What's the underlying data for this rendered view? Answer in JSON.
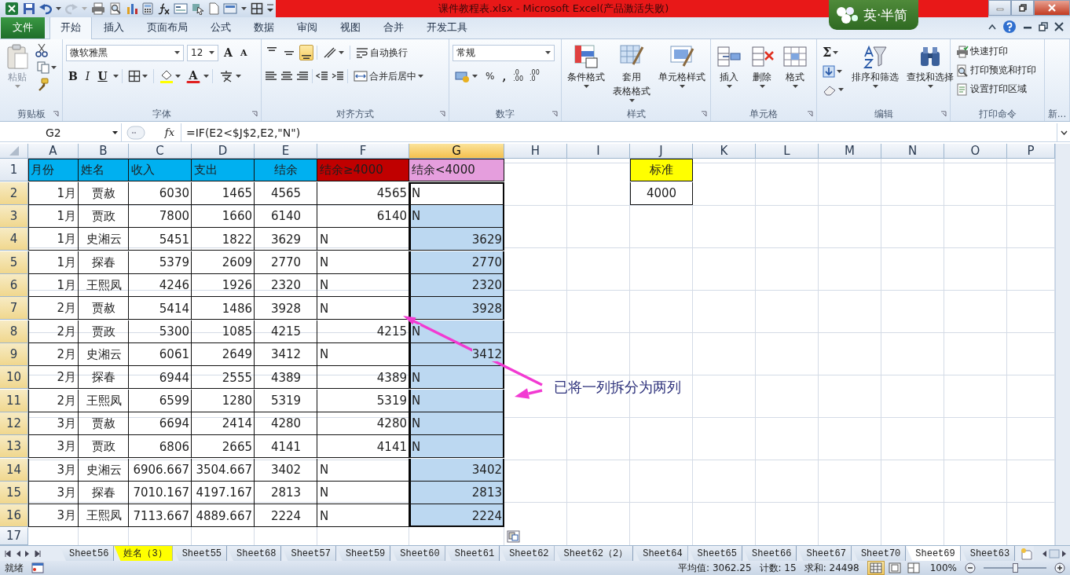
{
  "window": {
    "title": "课件教程表.xlsx - Microsoft Excel(产品激活失败)",
    "ime_badge": "英·半简"
  },
  "ribbon_tabs": [
    {
      "label": "文件",
      "kind": "file",
      "selected": false
    },
    {
      "label": "开始",
      "kind": "tab",
      "selected": true
    },
    {
      "label": "插入",
      "kind": "tab",
      "selected": false
    },
    {
      "label": "页面布局",
      "kind": "tab",
      "selected": false
    },
    {
      "label": "公式",
      "kind": "tab",
      "selected": false
    },
    {
      "label": "数据",
      "kind": "tab",
      "selected": false
    },
    {
      "label": "审阅",
      "kind": "tab",
      "selected": false
    },
    {
      "label": "视图",
      "kind": "tab",
      "selected": false
    },
    {
      "label": "合并",
      "kind": "tab",
      "selected": false
    },
    {
      "label": "开发工具",
      "kind": "tab",
      "selected": false
    }
  ],
  "ribbon": {
    "groups": [
      {
        "kind": "clipboard",
        "label": "剪贴板",
        "paste": "粘贴"
      },
      {
        "kind": "font",
        "label": "字体",
        "font_name": "微软雅黑",
        "font_size": "12",
        "grow": "A",
        "shrink": "A",
        "bold": "B",
        "italic": "I",
        "underline": "U",
        "font_color": "A"
      },
      {
        "kind": "alignment",
        "label": "对齐方式",
        "vertical_align": [
          {
            "selected": false
          },
          {
            "selected": false
          },
          {
            "selected": true
          }
        ],
        "wrap_text": "自动换行",
        "merge_center": "合并后居中"
      },
      {
        "kind": "number",
        "label": "数字",
        "format": "常规",
        "percent": "%",
        "comma": ",",
        "decimals": [
          {
            "top": ".0",
            "bottom": ".00"
          },
          {
            "top": ".00",
            "bottom": ".0"
          }
        ]
      },
      {
        "kind": "styles",
        "label": "样式",
        "buttons": [
          {
            "lines": [
              "条件格式"
            ]
          },
          {
            "lines": [
              "套用",
              "表格格式"
            ]
          },
          {
            "lines": [
              "单元格样式"
            ]
          }
        ]
      },
      {
        "kind": "cells",
        "label": "单元格",
        "buttons": [
          {
            "lines": [
              "插入"
            ]
          },
          {
            "lines": [
              "删除"
            ]
          },
          {
            "lines": [
              "格式"
            ]
          }
        ]
      },
      {
        "kind": "editing",
        "label": "编辑",
        "sum": "Σ",
        "buttons": [
          {
            "lines": [
              "排序和筛选"
            ]
          },
          {
            "lines": [
              "查找和选择"
            ]
          }
        ]
      },
      {
        "kind": "print",
        "label": "打印命令",
        "items": [
          "快速打印",
          "打印预览和打印",
          "设置打印区域"
        ]
      },
      {
        "kind": "more",
        "label": "新..."
      }
    ]
  },
  "formula_bar": {
    "name_box": "G2",
    "function_icon": "fx",
    "formula": "=IF(E2<$J$2,E2,\"N\")"
  },
  "grid": {
    "columns": [
      {
        "label": "A",
        "selected": false
      },
      {
        "label": "B",
        "selected": false
      },
      {
        "label": "C",
        "selected": false
      },
      {
        "label": "D",
        "selected": false
      },
      {
        "label": "E",
        "selected": false
      },
      {
        "label": "F",
        "selected": false
      },
      {
        "label": "G",
        "selected": true
      },
      {
        "label": "H",
        "selected": false
      },
      {
        "label": "I",
        "selected": false
      },
      {
        "label": "J",
        "selected": false
      },
      {
        "label": "K",
        "selected": false
      },
      {
        "label": "L",
        "selected": false
      },
      {
        "label": "M",
        "selected": false
      },
      {
        "label": "N",
        "selected": false
      },
      {
        "label": "O",
        "selected": false
      },
      {
        "label": "P",
        "selected": false
      }
    ],
    "rows": [
      {
        "label": "1",
        "selected": false,
        "cells": [
          {
            "text": "月份",
            "color": "#00b0f0"
          },
          {
            "text": "姓名",
            "color": "#00b0f0"
          },
          {
            "text": "收入",
            "color": "#00b0f0"
          },
          {
            "text": "支出",
            "color": "#00b0f0"
          },
          {
            "text": "结余",
            "color": "#00b0f0"
          },
          {
            "text": "结余≥4000",
            "color": "#c00000"
          },
          {
            "text": "结余<4000",
            "color": "#e59edd"
          }
        ],
        "criteria_cell": {
          "text": "标准",
          "color": "#ffff00"
        }
      },
      {
        "label": "2",
        "selected": true,
        "cells": [
          "1月",
          "贾赦",
          "6030",
          "1465",
          "4565",
          "4565",
          "N"
        ],
        "criteria_cell": {
          "text": "4000"
        }
      },
      {
        "label": "3",
        "selected": true,
        "cells": [
          "1月",
          "贾政",
          "7800",
          "1660",
          "6140",
          "6140",
          "N"
        ]
      },
      {
        "label": "4",
        "selected": true,
        "cells": [
          "1月",
          "史湘云",
          "5451",
          "1822",
          "3629",
          "N",
          "3629"
        ]
      },
      {
        "label": "5",
        "selected": true,
        "cells": [
          "1月",
          "探春",
          "5379",
          "2609",
          "2770",
          "N",
          "2770"
        ]
      },
      {
        "label": "6",
        "selected": true,
        "cells": [
          "1月",
          "王熙凤",
          "4246",
          "1926",
          "2320",
          "N",
          "2320"
        ]
      },
      {
        "label": "7",
        "selected": true,
        "cells": [
          "2月",
          "贾赦",
          "5414",
          "1486",
          "3928",
          "N",
          "3928"
        ]
      },
      {
        "label": "8",
        "selected": true,
        "cells": [
          "2月",
          "贾政",
          "5300",
          "1085",
          "4215",
          "4215",
          "N"
        ]
      },
      {
        "label": "9",
        "selected": true,
        "cells": [
          "2月",
          "史湘云",
          "6061",
          "2649",
          "3412",
          "N",
          "3412"
        ]
      },
      {
        "label": "10",
        "selected": true,
        "cells": [
          "2月",
          "探春",
          "6944",
          "2555",
          "4389",
          "4389",
          "N"
        ]
      },
      {
        "label": "11",
        "selected": true,
        "cells": [
          "2月",
          "王熙凤",
          "6599",
          "1280",
          "5319",
          "5319",
          "N"
        ]
      },
      {
        "label": "12",
        "selected": true,
        "cells": [
          "3月",
          "贾赦",
          "6694",
          "2414",
          "4280",
          "4280",
          "N"
        ]
      },
      {
        "label": "13",
        "selected": true,
        "cells": [
          "3月",
          "贾政",
          "6806",
          "2665",
          "4141",
          "4141",
          "N"
        ]
      },
      {
        "label": "14",
        "selected": true,
        "cells": [
          "3月",
          "史湘云",
          "6906.667",
          "3504.667",
          "3402",
          "N",
          "3402"
        ]
      },
      {
        "label": "15",
        "selected": true,
        "cells": [
          "3月",
          "探春",
          "7010.167",
          "4197.167",
          "2813",
          "N",
          "2813"
        ]
      },
      {
        "label": "16",
        "selected": true,
        "cells": [
          "3月",
          "王熙凤",
          "7113.667",
          "4889.667",
          "2224",
          "N",
          "2224"
        ]
      },
      {
        "label": "17",
        "selected": false,
        "cells": []
      }
    ],
    "annotation": {
      "text": "已将一列拆分为两列"
    }
  },
  "sheet_tabs": [
    {
      "label": "Sheet56",
      "selected": false
    },
    {
      "label": "姓名（3）",
      "selected": false,
      "color": "#ffff00"
    },
    {
      "label": "Sheet55",
      "selected": false
    },
    {
      "label": "Sheet68",
      "selected": false
    },
    {
      "label": "Sheet57",
      "selected": false
    },
    {
      "label": "Sheet59",
      "selected": false
    },
    {
      "label": "Sheet60",
      "selected": false
    },
    {
      "label": "Sheet61",
      "selected": false
    },
    {
      "label": "Sheet62",
      "selected": false
    },
    {
      "label": "Sheet62（2）",
      "selected": false
    },
    {
      "label": "Sheet64",
      "selected": false
    },
    {
      "label": "Sheet65",
      "selected": false
    },
    {
      "label": "Sheet66",
      "selected": false
    },
    {
      "label": "Sheet67",
      "selected": false
    },
    {
      "label": "Sheet70",
      "selected": false
    },
    {
      "label": "Sheet69",
      "selected": true
    },
    {
      "label": "Sheet63",
      "selected": false
    }
  ],
  "status_bar": {
    "mode": "就绪",
    "average": "平均值: 3062.25",
    "count": "计数: 15",
    "sum": "求和: 24498",
    "views": [
      {
        "kind": "normal",
        "selected": true
      },
      {
        "kind": "page_layout",
        "selected": false
      },
      {
        "kind": "page_break",
        "selected": false
      }
    ],
    "zoom": "100%",
    "zoom_slider": {
      "level": 0.5
    }
  }
}
